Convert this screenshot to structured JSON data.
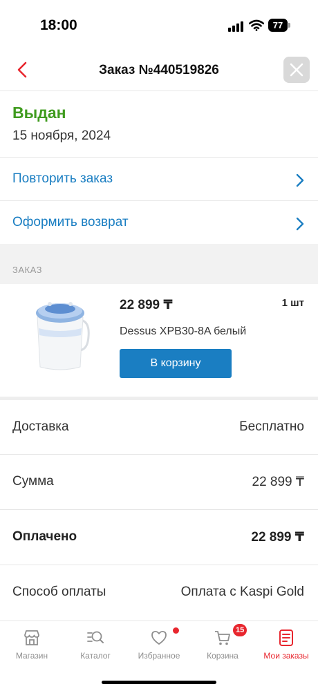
{
  "status_bar": {
    "time": "18:00",
    "battery": "77"
  },
  "header": {
    "title": "Заказ №440519826"
  },
  "order": {
    "status": "Выдан",
    "date": "15 ноября, 2024"
  },
  "actions": [
    {
      "label": "Повторить заказ"
    },
    {
      "label": "Оформить возврат"
    }
  ],
  "section": {
    "label": "ЗАКАЗ"
  },
  "product": {
    "price": "22 899 ₸",
    "qty": "1 шт",
    "name": "Dessus XPB30-8A белый",
    "cart_button": "В корзину"
  },
  "info_rows": [
    {
      "label": "Доставка",
      "value": "Бесплатно"
    },
    {
      "label": "Сумма",
      "value": "22 899 ₸"
    },
    {
      "label": "Оплачено",
      "value": "22 899 ₸"
    },
    {
      "label": "Способ оплаты",
      "value": "Оплата с Kaspi Gold"
    }
  ],
  "tabs": [
    {
      "label": "Магазин",
      "icon": "store-icon"
    },
    {
      "label": "Каталог",
      "icon": "catalog-icon"
    },
    {
      "label": "Избранное",
      "icon": "heart-icon"
    },
    {
      "label": "Корзина",
      "icon": "cart-icon",
      "badge": "15"
    },
    {
      "label": "Мои заказы",
      "icon": "orders-icon"
    }
  ],
  "colors": {
    "accent_blue": "#1a7ec2",
    "status_green": "#3f9b1e",
    "brand_red": "#e8262e"
  }
}
